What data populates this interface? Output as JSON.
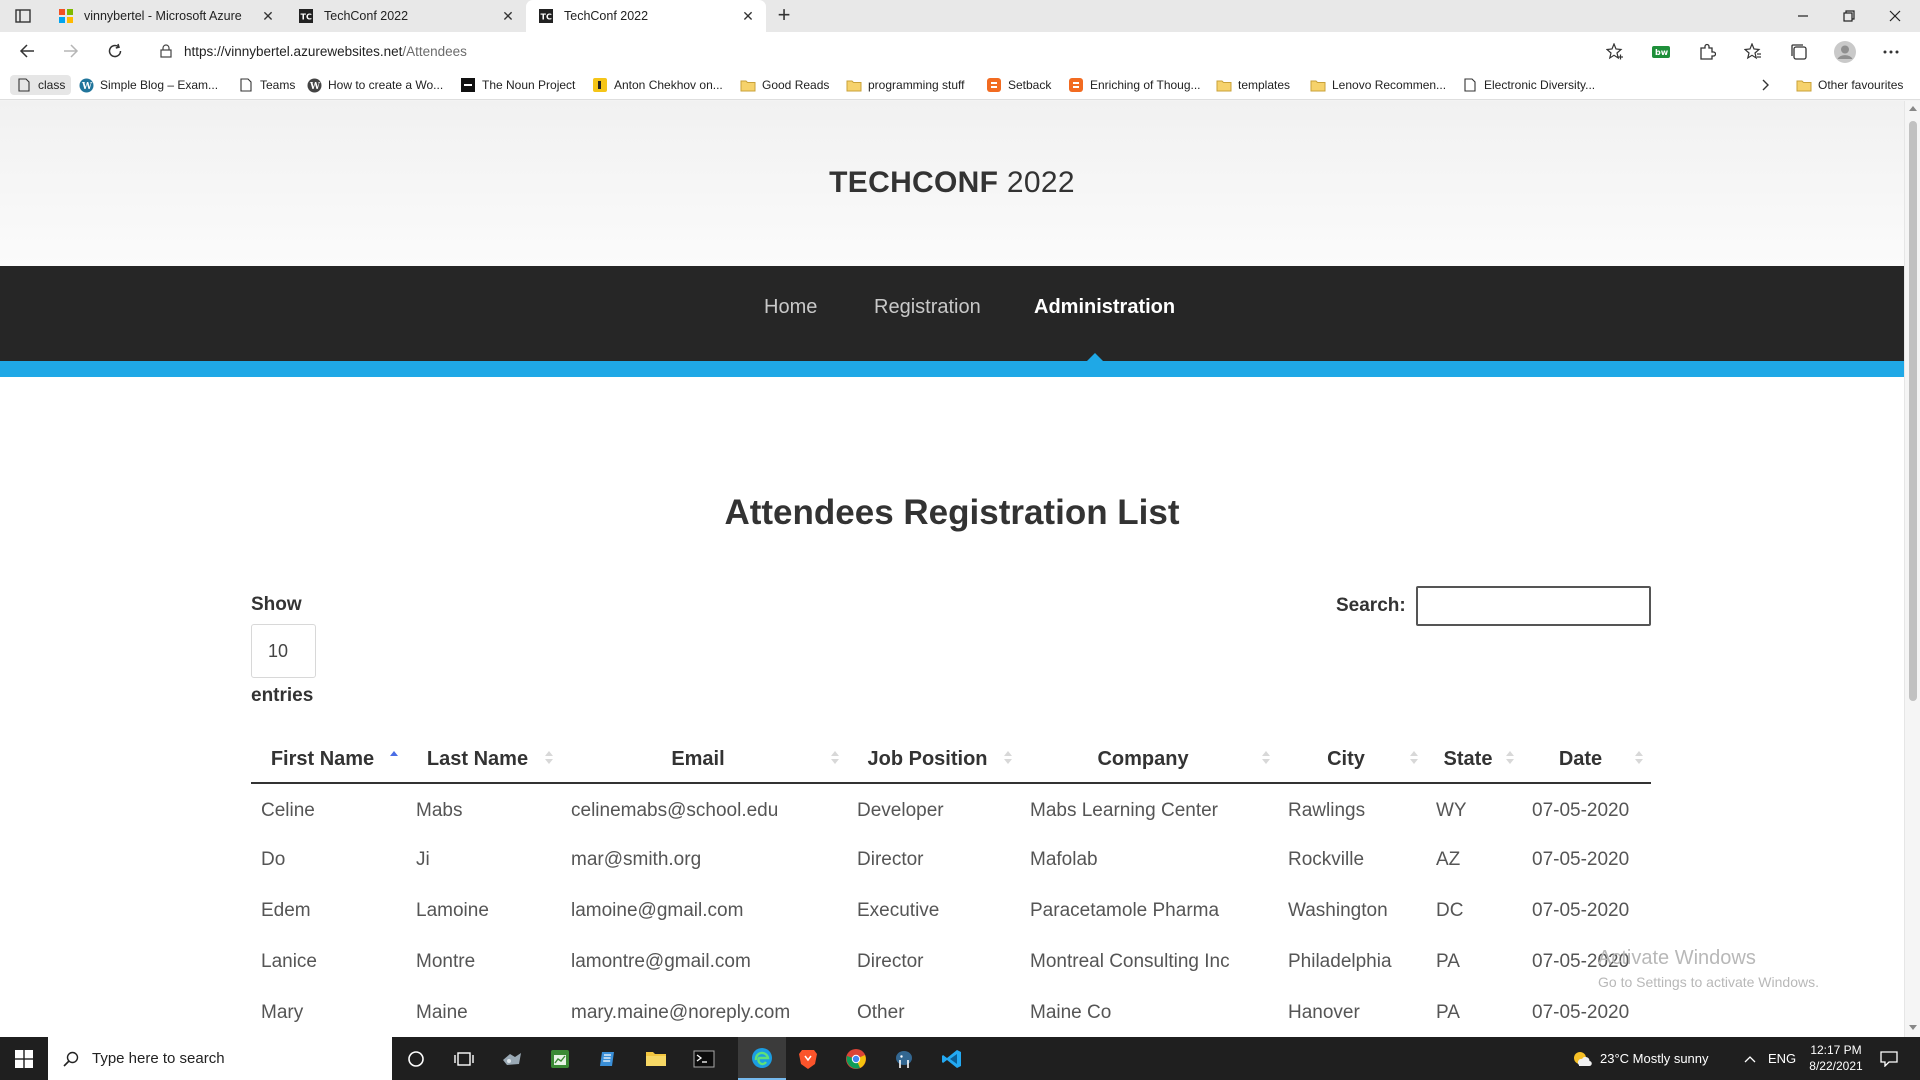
{
  "browser": {
    "tabs": [
      {
        "title": "vinnybertel - Microsoft Azure",
        "icon": "azure-icon",
        "active": false
      },
      {
        "title": "TechConf 2022",
        "icon": "tc-icon",
        "active": false
      },
      {
        "title": "TechConf 2022",
        "icon": "tc-icon",
        "active": true
      }
    ],
    "url_host": "https://vinnybertel.azurewebsites.net",
    "url_path": "/Attendees",
    "bookmarks": [
      {
        "label": "class",
        "icon": "page-icon"
      },
      {
        "label": "Simple Blog – Exam...",
        "icon": "wordpress-icon"
      },
      {
        "label": "Teams",
        "icon": "page-icon"
      },
      {
        "label": "How to create a Wo...",
        "icon": "wordpress-icon"
      },
      {
        "label": "The Noun Project",
        "icon": "noun-project-icon"
      },
      {
        "label": "Anton Chekhov on...",
        "icon": "bookmark-icon"
      },
      {
        "label": "Good Reads",
        "icon": "folder-icon"
      },
      {
        "label": "programming stuff",
        "icon": "folder-icon"
      },
      {
        "label": "Setback",
        "icon": "blogger-icon"
      },
      {
        "label": "Enriching of Thoug...",
        "icon": "blogger-icon"
      },
      {
        "label": "templates",
        "icon": "folder-icon"
      },
      {
        "label": "Lenovo Recommen...",
        "icon": "folder-icon"
      },
      {
        "label": "Electronic Diversity...",
        "icon": "page-icon"
      }
    ],
    "other_favourites": "Other favourites"
  },
  "site": {
    "brand_bold": "TECHCONF",
    "brand_year": " 2022",
    "nav": [
      {
        "label": "Home",
        "active": false
      },
      {
        "label": "Registration",
        "active": false
      },
      {
        "label": "Administration",
        "active": true
      }
    ],
    "accent_color": "#1fa8e6"
  },
  "page": {
    "title": "Attendees Registration List",
    "show_label": "Show",
    "show_value": "10",
    "entries_label": "entries",
    "search_label": "Search:",
    "search_value": ""
  },
  "table": {
    "columns": [
      "First Name",
      "Last Name",
      "Email",
      "Job Position",
      "Company",
      "City",
      "State",
      "Date"
    ],
    "sorted_column": "First Name",
    "rows": [
      [
        "Celine",
        "Mabs",
        "celinemabs@school.edu",
        "Developer",
        "Mabs Learning Center",
        "Rawlings",
        "WY",
        "07-05-2020"
      ],
      [
        "Do",
        "Ji",
        "mar@smith.org",
        "Director",
        "Mafolab",
        "Rockville",
        "AZ",
        "07-05-2020"
      ],
      [
        "Edem",
        "Lamoine",
        "lamoine@gmail.com",
        "Executive",
        "Paracetamole Pharma",
        "Washington",
        "DC",
        "07-05-2020"
      ],
      [
        "Lanice",
        "Montre",
        "lamontre@gmail.com",
        "Director",
        "Montreal Consulting Inc",
        "Philadelphia",
        "PA",
        "07-05-2020"
      ],
      [
        "Mary",
        "Maine",
        "mary.maine@noreply.com",
        "Other",
        "Maine Co",
        "Hanover",
        "PA",
        "07-05-2020"
      ]
    ]
  },
  "watermark": {
    "line1": "Activate Windows",
    "line2": "Go to Settings to activate Windows."
  },
  "taskbar": {
    "search_placeholder": "Type here to search",
    "weather": "23°C  Mostly sunny",
    "language": "ENG",
    "time": "12:17 PM",
    "date": "8/22/2021"
  }
}
